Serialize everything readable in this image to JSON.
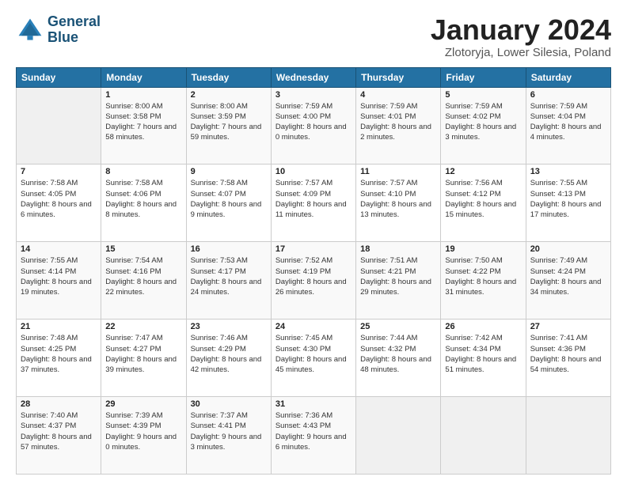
{
  "logo": {
    "line1": "General",
    "line2": "Blue"
  },
  "header": {
    "month": "January 2024",
    "location": "Zlotoryja, Lower Silesia, Poland"
  },
  "weekdays": [
    "Sunday",
    "Monday",
    "Tuesday",
    "Wednesday",
    "Thursday",
    "Friday",
    "Saturday"
  ],
  "weeks": [
    [
      {
        "day": "",
        "sunrise": "",
        "sunset": "",
        "daylight": ""
      },
      {
        "day": "1",
        "sunrise": "Sunrise: 8:00 AM",
        "sunset": "Sunset: 3:58 PM",
        "daylight": "Daylight: 7 hours and 58 minutes."
      },
      {
        "day": "2",
        "sunrise": "Sunrise: 8:00 AM",
        "sunset": "Sunset: 3:59 PM",
        "daylight": "Daylight: 7 hours and 59 minutes."
      },
      {
        "day": "3",
        "sunrise": "Sunrise: 7:59 AM",
        "sunset": "Sunset: 4:00 PM",
        "daylight": "Daylight: 8 hours and 0 minutes."
      },
      {
        "day": "4",
        "sunrise": "Sunrise: 7:59 AM",
        "sunset": "Sunset: 4:01 PM",
        "daylight": "Daylight: 8 hours and 2 minutes."
      },
      {
        "day": "5",
        "sunrise": "Sunrise: 7:59 AM",
        "sunset": "Sunset: 4:02 PM",
        "daylight": "Daylight: 8 hours and 3 minutes."
      },
      {
        "day": "6",
        "sunrise": "Sunrise: 7:59 AM",
        "sunset": "Sunset: 4:04 PM",
        "daylight": "Daylight: 8 hours and 4 minutes."
      }
    ],
    [
      {
        "day": "7",
        "sunrise": "Sunrise: 7:58 AM",
        "sunset": "Sunset: 4:05 PM",
        "daylight": "Daylight: 8 hours and 6 minutes."
      },
      {
        "day": "8",
        "sunrise": "Sunrise: 7:58 AM",
        "sunset": "Sunset: 4:06 PM",
        "daylight": "Daylight: 8 hours and 8 minutes."
      },
      {
        "day": "9",
        "sunrise": "Sunrise: 7:58 AM",
        "sunset": "Sunset: 4:07 PM",
        "daylight": "Daylight: 8 hours and 9 minutes."
      },
      {
        "day": "10",
        "sunrise": "Sunrise: 7:57 AM",
        "sunset": "Sunset: 4:09 PM",
        "daylight": "Daylight: 8 hours and 11 minutes."
      },
      {
        "day": "11",
        "sunrise": "Sunrise: 7:57 AM",
        "sunset": "Sunset: 4:10 PM",
        "daylight": "Daylight: 8 hours and 13 minutes."
      },
      {
        "day": "12",
        "sunrise": "Sunrise: 7:56 AM",
        "sunset": "Sunset: 4:12 PM",
        "daylight": "Daylight: 8 hours and 15 minutes."
      },
      {
        "day": "13",
        "sunrise": "Sunrise: 7:55 AM",
        "sunset": "Sunset: 4:13 PM",
        "daylight": "Daylight: 8 hours and 17 minutes."
      }
    ],
    [
      {
        "day": "14",
        "sunrise": "Sunrise: 7:55 AM",
        "sunset": "Sunset: 4:14 PM",
        "daylight": "Daylight: 8 hours and 19 minutes."
      },
      {
        "day": "15",
        "sunrise": "Sunrise: 7:54 AM",
        "sunset": "Sunset: 4:16 PM",
        "daylight": "Daylight: 8 hours and 22 minutes."
      },
      {
        "day": "16",
        "sunrise": "Sunrise: 7:53 AM",
        "sunset": "Sunset: 4:17 PM",
        "daylight": "Daylight: 8 hours and 24 minutes."
      },
      {
        "day": "17",
        "sunrise": "Sunrise: 7:52 AM",
        "sunset": "Sunset: 4:19 PM",
        "daylight": "Daylight: 8 hours and 26 minutes."
      },
      {
        "day": "18",
        "sunrise": "Sunrise: 7:51 AM",
        "sunset": "Sunset: 4:21 PM",
        "daylight": "Daylight: 8 hours and 29 minutes."
      },
      {
        "day": "19",
        "sunrise": "Sunrise: 7:50 AM",
        "sunset": "Sunset: 4:22 PM",
        "daylight": "Daylight: 8 hours and 31 minutes."
      },
      {
        "day": "20",
        "sunrise": "Sunrise: 7:49 AM",
        "sunset": "Sunset: 4:24 PM",
        "daylight": "Daylight: 8 hours and 34 minutes."
      }
    ],
    [
      {
        "day": "21",
        "sunrise": "Sunrise: 7:48 AM",
        "sunset": "Sunset: 4:25 PM",
        "daylight": "Daylight: 8 hours and 37 minutes."
      },
      {
        "day": "22",
        "sunrise": "Sunrise: 7:47 AM",
        "sunset": "Sunset: 4:27 PM",
        "daylight": "Daylight: 8 hours and 39 minutes."
      },
      {
        "day": "23",
        "sunrise": "Sunrise: 7:46 AM",
        "sunset": "Sunset: 4:29 PM",
        "daylight": "Daylight: 8 hours and 42 minutes."
      },
      {
        "day": "24",
        "sunrise": "Sunrise: 7:45 AM",
        "sunset": "Sunset: 4:30 PM",
        "daylight": "Daylight: 8 hours and 45 minutes."
      },
      {
        "day": "25",
        "sunrise": "Sunrise: 7:44 AM",
        "sunset": "Sunset: 4:32 PM",
        "daylight": "Daylight: 8 hours and 48 minutes."
      },
      {
        "day": "26",
        "sunrise": "Sunrise: 7:42 AM",
        "sunset": "Sunset: 4:34 PM",
        "daylight": "Daylight: 8 hours and 51 minutes."
      },
      {
        "day": "27",
        "sunrise": "Sunrise: 7:41 AM",
        "sunset": "Sunset: 4:36 PM",
        "daylight": "Daylight: 8 hours and 54 minutes."
      }
    ],
    [
      {
        "day": "28",
        "sunrise": "Sunrise: 7:40 AM",
        "sunset": "Sunset: 4:37 PM",
        "daylight": "Daylight: 8 hours and 57 minutes."
      },
      {
        "day": "29",
        "sunrise": "Sunrise: 7:39 AM",
        "sunset": "Sunset: 4:39 PM",
        "daylight": "Daylight: 9 hours and 0 minutes."
      },
      {
        "day": "30",
        "sunrise": "Sunrise: 7:37 AM",
        "sunset": "Sunset: 4:41 PM",
        "daylight": "Daylight: 9 hours and 3 minutes."
      },
      {
        "day": "31",
        "sunrise": "Sunrise: 7:36 AM",
        "sunset": "Sunset: 4:43 PM",
        "daylight": "Daylight: 9 hours and 6 minutes."
      },
      {
        "day": "",
        "sunrise": "",
        "sunset": "",
        "daylight": ""
      },
      {
        "day": "",
        "sunrise": "",
        "sunset": "",
        "daylight": ""
      },
      {
        "day": "",
        "sunrise": "",
        "sunset": "",
        "daylight": ""
      }
    ]
  ]
}
